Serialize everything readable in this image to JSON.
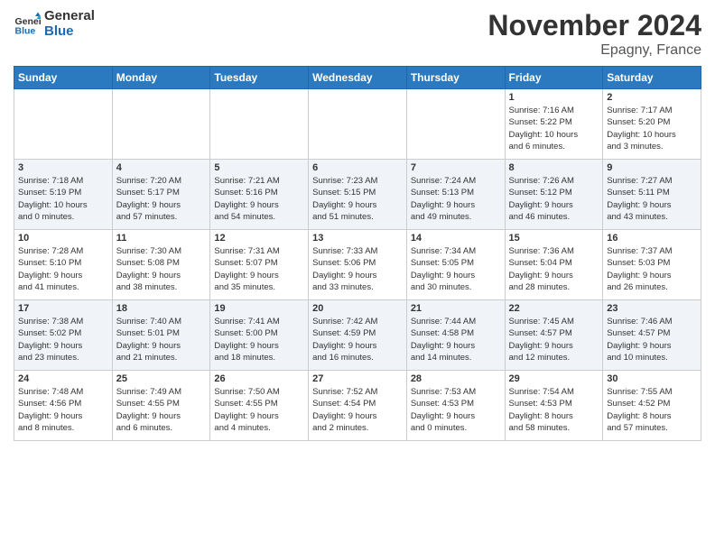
{
  "header": {
    "logo_line1": "General",
    "logo_line2": "Blue",
    "month": "November 2024",
    "location": "Epagny, France"
  },
  "weekdays": [
    "Sunday",
    "Monday",
    "Tuesday",
    "Wednesday",
    "Thursday",
    "Friday",
    "Saturday"
  ],
  "weeks": [
    [
      {
        "day": "",
        "info": ""
      },
      {
        "day": "",
        "info": ""
      },
      {
        "day": "",
        "info": ""
      },
      {
        "day": "",
        "info": ""
      },
      {
        "day": "",
        "info": ""
      },
      {
        "day": "1",
        "info": "Sunrise: 7:16 AM\nSunset: 5:22 PM\nDaylight: 10 hours\nand 6 minutes."
      },
      {
        "day": "2",
        "info": "Sunrise: 7:17 AM\nSunset: 5:20 PM\nDaylight: 10 hours\nand 3 minutes."
      }
    ],
    [
      {
        "day": "3",
        "info": "Sunrise: 7:18 AM\nSunset: 5:19 PM\nDaylight: 10 hours\nand 0 minutes."
      },
      {
        "day": "4",
        "info": "Sunrise: 7:20 AM\nSunset: 5:17 PM\nDaylight: 9 hours\nand 57 minutes."
      },
      {
        "day": "5",
        "info": "Sunrise: 7:21 AM\nSunset: 5:16 PM\nDaylight: 9 hours\nand 54 minutes."
      },
      {
        "day": "6",
        "info": "Sunrise: 7:23 AM\nSunset: 5:15 PM\nDaylight: 9 hours\nand 51 minutes."
      },
      {
        "day": "7",
        "info": "Sunrise: 7:24 AM\nSunset: 5:13 PM\nDaylight: 9 hours\nand 49 minutes."
      },
      {
        "day": "8",
        "info": "Sunrise: 7:26 AM\nSunset: 5:12 PM\nDaylight: 9 hours\nand 46 minutes."
      },
      {
        "day": "9",
        "info": "Sunrise: 7:27 AM\nSunset: 5:11 PM\nDaylight: 9 hours\nand 43 minutes."
      }
    ],
    [
      {
        "day": "10",
        "info": "Sunrise: 7:28 AM\nSunset: 5:10 PM\nDaylight: 9 hours\nand 41 minutes."
      },
      {
        "day": "11",
        "info": "Sunrise: 7:30 AM\nSunset: 5:08 PM\nDaylight: 9 hours\nand 38 minutes."
      },
      {
        "day": "12",
        "info": "Sunrise: 7:31 AM\nSunset: 5:07 PM\nDaylight: 9 hours\nand 35 minutes."
      },
      {
        "day": "13",
        "info": "Sunrise: 7:33 AM\nSunset: 5:06 PM\nDaylight: 9 hours\nand 33 minutes."
      },
      {
        "day": "14",
        "info": "Sunrise: 7:34 AM\nSunset: 5:05 PM\nDaylight: 9 hours\nand 30 minutes."
      },
      {
        "day": "15",
        "info": "Sunrise: 7:36 AM\nSunset: 5:04 PM\nDaylight: 9 hours\nand 28 minutes."
      },
      {
        "day": "16",
        "info": "Sunrise: 7:37 AM\nSunset: 5:03 PM\nDaylight: 9 hours\nand 26 minutes."
      }
    ],
    [
      {
        "day": "17",
        "info": "Sunrise: 7:38 AM\nSunset: 5:02 PM\nDaylight: 9 hours\nand 23 minutes."
      },
      {
        "day": "18",
        "info": "Sunrise: 7:40 AM\nSunset: 5:01 PM\nDaylight: 9 hours\nand 21 minutes."
      },
      {
        "day": "19",
        "info": "Sunrise: 7:41 AM\nSunset: 5:00 PM\nDaylight: 9 hours\nand 18 minutes."
      },
      {
        "day": "20",
        "info": "Sunrise: 7:42 AM\nSunset: 4:59 PM\nDaylight: 9 hours\nand 16 minutes."
      },
      {
        "day": "21",
        "info": "Sunrise: 7:44 AM\nSunset: 4:58 PM\nDaylight: 9 hours\nand 14 minutes."
      },
      {
        "day": "22",
        "info": "Sunrise: 7:45 AM\nSunset: 4:57 PM\nDaylight: 9 hours\nand 12 minutes."
      },
      {
        "day": "23",
        "info": "Sunrise: 7:46 AM\nSunset: 4:57 PM\nDaylight: 9 hours\nand 10 minutes."
      }
    ],
    [
      {
        "day": "24",
        "info": "Sunrise: 7:48 AM\nSunset: 4:56 PM\nDaylight: 9 hours\nand 8 minutes."
      },
      {
        "day": "25",
        "info": "Sunrise: 7:49 AM\nSunset: 4:55 PM\nDaylight: 9 hours\nand 6 minutes."
      },
      {
        "day": "26",
        "info": "Sunrise: 7:50 AM\nSunset: 4:55 PM\nDaylight: 9 hours\nand 4 minutes."
      },
      {
        "day": "27",
        "info": "Sunrise: 7:52 AM\nSunset: 4:54 PM\nDaylight: 9 hours\nand 2 minutes."
      },
      {
        "day": "28",
        "info": "Sunrise: 7:53 AM\nSunset: 4:53 PM\nDaylight: 9 hours\nand 0 minutes."
      },
      {
        "day": "29",
        "info": "Sunrise: 7:54 AM\nSunset: 4:53 PM\nDaylight: 8 hours\nand 58 minutes."
      },
      {
        "day": "30",
        "info": "Sunrise: 7:55 AM\nSunset: 4:52 PM\nDaylight: 8 hours\nand 57 minutes."
      }
    ]
  ]
}
